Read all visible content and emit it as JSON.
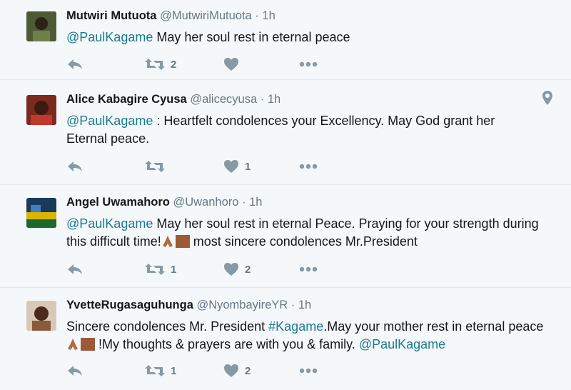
{
  "colors": {
    "accent": "#1b7a8e",
    "icon": "#8899a6",
    "text": "#14171a",
    "muted": "#657786",
    "background": "#f5f8fa"
  },
  "tweets": [
    {
      "name": "Mutwiri Mutuota",
      "handle": "@MutwiriMutuota",
      "separator": "·",
      "time": "1h",
      "mention": "@PaulKagame",
      "text": " May her soul rest in eternal peace",
      "retweets": "2",
      "likes": "",
      "has_location": false
    },
    {
      "name": "Alice Kabagire Cyusa",
      "handle": "@alicecyusa",
      "separator": "·",
      "time": "1h",
      "mention": "@PaulKagame",
      "text": " : Heartfelt condolences your Excellency. May God grant her Eternal peace.",
      "retweets": "",
      "likes": "1",
      "has_location": true
    },
    {
      "name": "Angel Uwamahoro",
      "handle": "@Uwanhoro",
      "separator": "·",
      "time": "1h",
      "mention": "@PaulKagame",
      "text": " May her soul rest in eternal Peace. Praying for your strength during this difficult time!",
      "text_after": " most sincere condolences Mr.President",
      "retweets": "1",
      "likes": "2",
      "has_location": false
    },
    {
      "name": "YvetteRugasaguhunga",
      "handle": "@NyombayireYR",
      "separator": "·",
      "time": "1h",
      "text_before": "Sincere condolences Mr. President ",
      "hashtag": "#Kagame",
      "text": ".May your mother rest in eternal peace",
      "text_after": " !My thoughts & prayers are with you & family. ",
      "mention": "@PaulKagame",
      "retweets": "1",
      "likes": "2",
      "has_location": false
    }
  ]
}
